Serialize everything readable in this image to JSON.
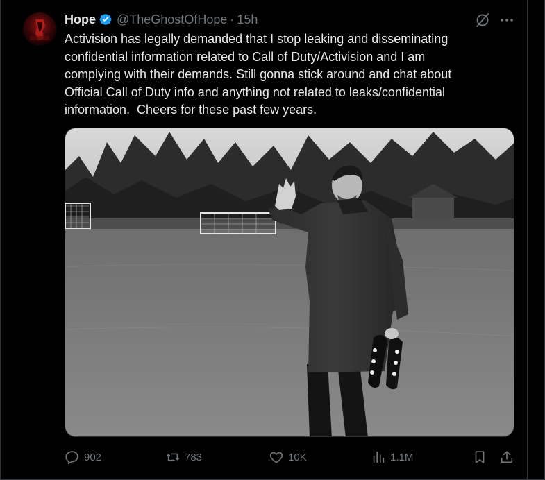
{
  "tweet": {
    "display_name": "Hope",
    "handle": "@TheGhostOfHope",
    "separator": "·",
    "time": "15h",
    "text_lines": [
      "Activision has legally demanded that I stop leaking and disseminating",
      "confidential information related to Call of Duty/Activision and I am",
      "complying with their demands. Still gonna stick around and chat about",
      "Official Call of Duty info and anything not related to leaks/confidential",
      "information.  Cheers for these past few years."
    ]
  },
  "metrics": {
    "replies": "902",
    "reposts": "783",
    "likes": "10K",
    "views": "1.1M"
  },
  "colors": {
    "background": "#000000",
    "text": "#e7e9ea",
    "muted": "#71767b",
    "verified": "#1d9bf0",
    "border": "#2f3336"
  },
  "icons": {
    "verified": "verified-badge-icon",
    "grok": "grok-icon",
    "more": "more-icon",
    "reply": "reply-icon",
    "repost": "repost-icon",
    "like": "like-icon",
    "views": "views-icon",
    "bookmark": "bookmark-icon",
    "share": "share-icon"
  }
}
